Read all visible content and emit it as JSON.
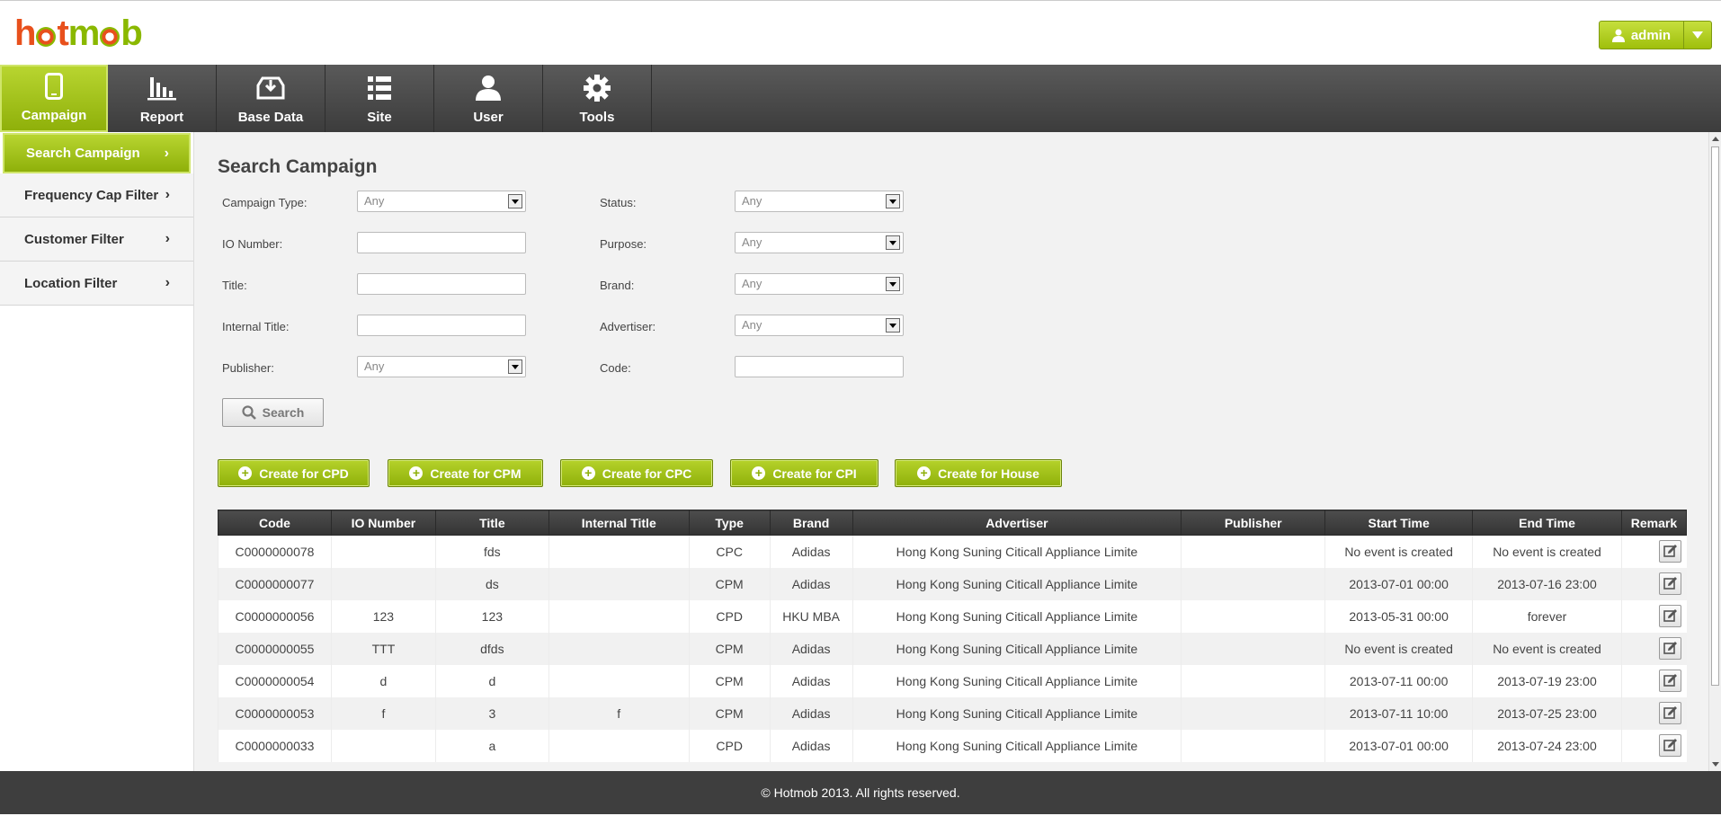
{
  "header": {
    "logo": "hotmob",
    "user_label": "admin"
  },
  "topnav": [
    {
      "label": "Campaign",
      "icon": "phone-icon"
    },
    {
      "label": "Report",
      "icon": "bar-chart-icon"
    },
    {
      "label": "Base Data",
      "icon": "download-tray-icon"
    },
    {
      "label": "Site",
      "icon": "list-icon"
    },
    {
      "label": "User",
      "icon": "person-icon"
    },
    {
      "label": "Tools",
      "icon": "gear-icon"
    }
  ],
  "sidenav": [
    {
      "label": "Search Campaign"
    },
    {
      "label": "Frequency Cap Filter"
    },
    {
      "label": "Customer Filter"
    },
    {
      "label": "Location Filter"
    }
  ],
  "main": {
    "title": "Search Campaign",
    "form": {
      "campaign_type": {
        "label": "Campaign Type:",
        "value": "Any"
      },
      "io_number": {
        "label": "IO Number:",
        "value": ""
      },
      "title": {
        "label": "Title:",
        "value": ""
      },
      "internal_title": {
        "label": "Internal Title:",
        "value": ""
      },
      "publisher": {
        "label": "Publisher:",
        "value": "Any"
      },
      "status": {
        "label": "Status:",
        "value": "Any"
      },
      "purpose": {
        "label": "Purpose:",
        "value": "Any"
      },
      "brand": {
        "label": "Brand:",
        "value": "Any"
      },
      "advertiser": {
        "label": "Advertiser:",
        "value": "Any"
      },
      "code": {
        "label": "Code:",
        "value": ""
      }
    },
    "search_label": "Search",
    "create_buttons": [
      "Create for CPD",
      "Create for CPM",
      "Create for CPC",
      "Create for CPI",
      "Create for House"
    ]
  },
  "table": {
    "headers": [
      "Code",
      "IO Number",
      "Title",
      "Internal Title",
      "Type",
      "Brand",
      "Advertiser",
      "Publisher",
      "Start Time",
      "End Time",
      "Remark"
    ],
    "rows": [
      [
        "C0000000078",
        "",
        "fds",
        "",
        "CPC",
        "Adidas",
        "Hong Kong Suning Citicall Appliance Limite",
        "",
        "No event is created",
        "No event is created",
        ""
      ],
      [
        "C0000000077",
        "",
        "ds",
        "",
        "CPM",
        "Adidas",
        "Hong Kong Suning Citicall Appliance Limite",
        "",
        "2013-07-01 00:00",
        "2013-07-16 23:00",
        ""
      ],
      [
        "C0000000056",
        "123",
        "123",
        "",
        "CPD",
        "HKU MBA",
        "Hong Kong Suning Citicall Appliance Limite",
        "",
        "2013-05-31 00:00",
        "forever",
        ""
      ],
      [
        "C0000000055",
        "TTT",
        "dfds",
        "",
        "CPM",
        "Adidas",
        "Hong Kong Suning Citicall Appliance Limite",
        "",
        "No event is created",
        "No event is created",
        ""
      ],
      [
        "C0000000054",
        "d",
        "d",
        "",
        "CPM",
        "Adidas",
        "Hong Kong Suning Citicall Appliance Limite",
        "",
        "2013-07-11 00:00",
        "2013-07-19 23:00",
        ""
      ],
      [
        "C0000000053",
        "f",
        "3",
        "f",
        "CPM",
        "Adidas",
        "Hong Kong Suning Citicall Appliance Limite",
        "",
        "2013-07-11 10:00",
        "2013-07-25 23:00",
        ""
      ],
      [
        "C0000000033",
        "",
        "a",
        "",
        "CPD",
        "Adidas",
        "Hong Kong Suning Citicall Appliance Limite",
        "",
        "2013-07-01 00:00",
        "2013-07-24 23:00",
        ""
      ]
    ]
  },
  "footer": {
    "text": "© Hotmob 2013. All rights reserved."
  },
  "colors": {
    "accent": "#9fbf0c",
    "nav_dark": "#444444",
    "logo_orange": "#e8501c"
  }
}
